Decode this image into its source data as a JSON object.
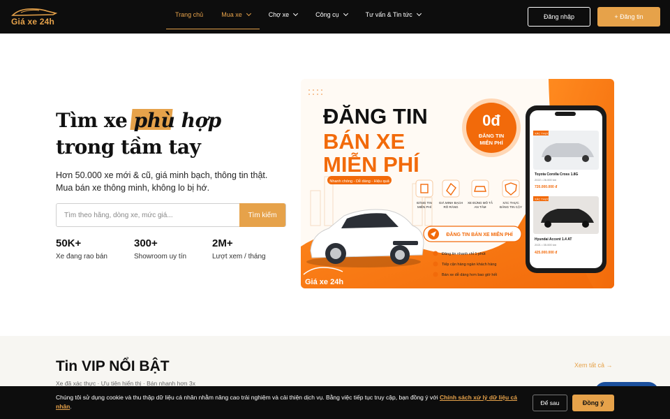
{
  "brand": {
    "logo_text": "Giá xe 24h",
    "accent_color": "#e6a24a"
  },
  "nav": {
    "items": [
      {
        "label": "Trang chủ",
        "has_dropdown": false
      },
      {
        "label": "Mua xe",
        "has_dropdown": true
      },
      {
        "label": "Chợ xe",
        "has_dropdown": true
      },
      {
        "label": "Công cụ",
        "has_dropdown": true
      },
      {
        "label": "Tư vấn & Tin tức",
        "has_dropdown": true
      }
    ],
    "login_label": "Đăng nhập",
    "post_label": "+ Đăng tin"
  },
  "hero": {
    "title_part1": "Tìm xe ",
    "title_highlight": "phù hợp",
    "title_line2": "trong tầm tay",
    "subtitle_line1": "Hơn 50.000 xe mới & cũ, giá minh bạch, thông tin thật.",
    "subtitle_line2": "Mua bán xe thông minh, không lo bị hớ.",
    "search_placeholder": "Tìm theo hãng, dòng xe, mức giá...",
    "search_button": "Tìm kiếm",
    "stats": [
      {
        "value": "50K+",
        "label": "Xe đang rao bán"
      },
      {
        "value": "300+",
        "label": "Showroom uy tín"
      },
      {
        "value": "2M+",
        "label": "Lượt xem / tháng"
      }
    ]
  },
  "banner": {
    "headline1": "ĐĂNG TIN",
    "headline2": "BÁN XE",
    "headline3": "MIỄN PHÍ",
    "badge_price": "0đ",
    "badge_line1": "ĐĂNG TIN",
    "badge_line2": "MIỄN PHÍ",
    "tagline": "Nhanh chóng - Dễ dàng - Hiệu quả",
    "features": [
      {
        "line1": "ĐĂNG TIN",
        "line2": "MIỄN PHÍ"
      },
      {
        "line1": "GIÁ MINH BẠCH",
        "line2": "RÕ RÀNG"
      },
      {
        "line1": "XE ĐÚNG MÔ TẢ",
        "line2": "AN TÂM"
      },
      {
        "line1": "XÁC THỰC",
        "line2": "ĐĂNG TIN CẬY"
      }
    ],
    "cta": "ĐĂNG TIN BÁN XE MIỄN PHÍ",
    "benefits": [
      "Đăng tin nhanh chỉ 1 phút",
      "Tiếp cận hàng ngàn khách hàng",
      "Bán xe dễ dàng hơn bao giờ hết"
    ],
    "logo_text": "Giá xe 24h",
    "phone_cards": [
      {
        "badge": "XÁC THỰC",
        "name": "Toyota Corolla Cross 1.8G",
        "meta": "2022 • 26.000 km",
        "price": "720.000.000 đ"
      },
      {
        "badge": "XÁC THỰC",
        "name": "Hyundai Accent 1.4 AT",
        "meta": "2021 • 35.000 km",
        "price": "425.000.000 đ"
      }
    ]
  },
  "vip": {
    "title": "Tin VIP NỔI BẬT",
    "subtitle": "Xe đã xác thực · Ưu tiên hiển thị · Bán nhanh hơn 3x",
    "see_all": "Xem tất cả →"
  },
  "cookie": {
    "text": "Chúng tôi sử dụng cookie và thu thập dữ liệu cá nhân nhằm nâng cao trải nghiệm và cải thiện dịch vụ. Bằng việc tiếp tục truy cập, bạn đồng ý với ",
    "link_text": "Chính sách xử lý dữ liệu cá nhân",
    "text_end": ".",
    "later_label": "Để sau",
    "agree_label": "Đồng ý"
  }
}
